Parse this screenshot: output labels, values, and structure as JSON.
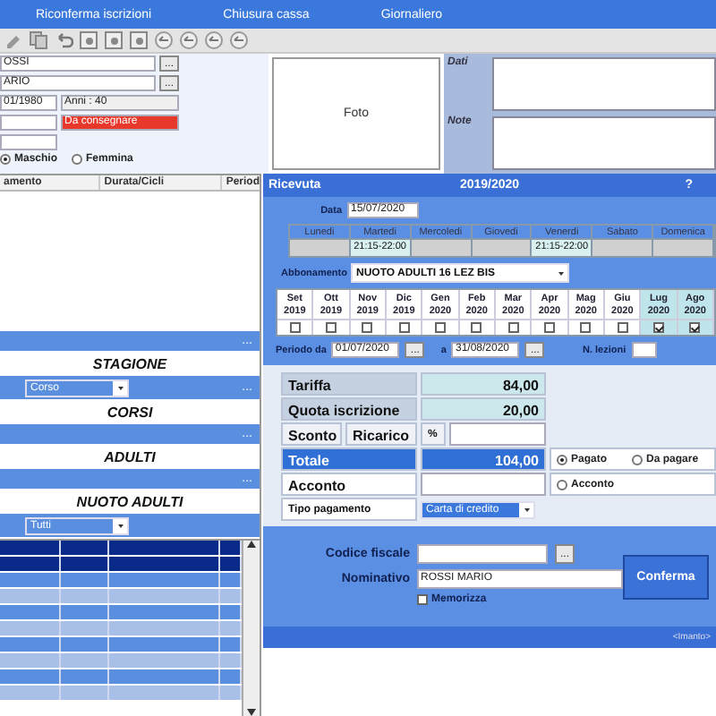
{
  "menu": [
    "Riconferma iscrizioni",
    "Chiusura cassa",
    "Giornaliero"
  ],
  "person": {
    "surname": "OSSI",
    "name": "ARIO",
    "birth": "01/1980",
    "age": "Anni : 40",
    "status": "Da consegnare",
    "browse": "...",
    "gender": [
      {
        "label": "Maschio",
        "selected": true
      },
      {
        "label": "Femmina",
        "selected": false
      }
    ]
  },
  "photo": "Foto",
  "details": {
    "dati": "Dati",
    "note": "Note"
  },
  "table": {
    "columns": [
      "amento",
      "Durata/Cicli",
      "Period"
    ]
  },
  "filters": [
    {
      "kind": "bar",
      "button": "..."
    },
    {
      "kind": "heading",
      "text": "STAGIONE"
    },
    {
      "kind": "select",
      "value": "Corso",
      "button": "..."
    },
    {
      "kind": "heading",
      "text": "CORSI"
    },
    {
      "kind": "bar",
      "button": "..."
    },
    {
      "kind": "heading",
      "text": "ADULTI"
    },
    {
      "kind": "bar",
      "button": "..."
    },
    {
      "kind": "heading",
      "text": "NUOTO ADULTI"
    },
    {
      "kind": "select",
      "value": "Tutti"
    }
  ],
  "grid": {
    "rows": [
      {
        "selected": true
      },
      {
        "selected": true
      },
      {
        "selected": false
      },
      {
        "selected": false
      },
      {
        "selected": false
      },
      {
        "selected": false
      },
      {
        "selected": false
      },
      {
        "selected": false
      },
      {
        "selected": false
      },
      {
        "selected": false
      }
    ]
  },
  "dialog": {
    "title": "Ricevuta",
    "season": "2019/2020",
    "help": "?",
    "date_label": "Data",
    "date": "15/07/2020",
    "days": [
      {
        "name": "Lunedi"
      },
      {
        "name": "Martedi",
        "time": "21:15-22:00"
      },
      {
        "name": "Mercoledi"
      },
      {
        "name": "Giovedi"
      },
      {
        "name": "Venerdi",
        "time": "21:15-22:00"
      },
      {
        "name": "Sabato"
      },
      {
        "name": "Domenica"
      }
    ],
    "subscription_label": "Abbonamento",
    "subscription": "NUOTO ADULTI 16 LEZ BIS",
    "months": [
      {
        "month": "Set",
        "year": "2019",
        "checked": false
      },
      {
        "month": "Ott",
        "year": "2019",
        "checked": false
      },
      {
        "month": "Nov",
        "year": "2019",
        "checked": false
      },
      {
        "month": "Dic",
        "year": "2019",
        "checked": false
      },
      {
        "month": "Gen",
        "year": "2020",
        "checked": false
      },
      {
        "month": "Feb",
        "year": "2020",
        "checked": false
      },
      {
        "month": "Mar",
        "year": "2020",
        "checked": false
      },
      {
        "month": "Apr",
        "year": "2020",
        "checked": false
      },
      {
        "month": "Mag",
        "year": "2020",
        "checked": false
      },
      {
        "month": "Giu",
        "year": "2020",
        "checked": false
      },
      {
        "month": "Lug",
        "year": "2020",
        "checked": true
      },
      {
        "month": "Ago",
        "year": "2020",
        "checked": true
      }
    ],
    "period_label": "Periodo da",
    "period_from": "01/07/2020",
    "period_to_label": "a",
    "period_to": "31/08/2020",
    "browse": "...",
    "lessons_label": "N. lezioni",
    "fee_label": "Tariffa",
    "fee": "84,00",
    "enrol_label": "Quota iscrizione",
    "enrol": "20,00",
    "discount_label": "Sconto",
    "surcharge_label": "Ricarico",
    "percent": "%",
    "total_label": "Totale",
    "total": "104,00",
    "deposit_label": "Acconto",
    "payment_status": [
      {
        "label": "Pagato",
        "selected": true
      },
      {
        "label": "Da pagare",
        "selected": false
      },
      {
        "label": "Acconto",
        "selected": false
      }
    ],
    "payment_type_label": "Tipo pagamento",
    "payment_type": "Carta di credito",
    "tax_code_label": "Codice fiscale",
    "holder_label": "Nominativo",
    "holder": "ROSSI MARIO",
    "remember": {
      "label": "Memorizza",
      "checked": false
    },
    "confirm": "Conferma",
    "footer": "<Imanto>"
  }
}
